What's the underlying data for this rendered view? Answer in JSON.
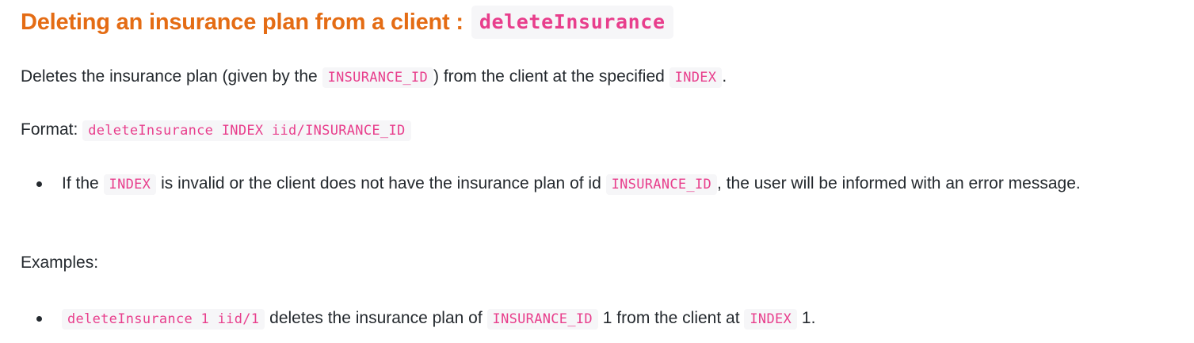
{
  "heading": {
    "text": "Deleting an insurance plan from a client :",
    "command": "deleteInsurance"
  },
  "description": {
    "part1": "Deletes the insurance plan (given by the",
    "code1": "INSURANCE_ID",
    "part2": ") from the client at the specified",
    "code2": "INDEX",
    "part3": "."
  },
  "format": {
    "label": "Format:",
    "code": "deleteInsurance INDEX iid/INSURANCE_ID"
  },
  "notes": [
    {
      "part1": "If the",
      "code1": "INDEX",
      "part2": "is invalid or the client does not have the insurance plan of id",
      "code2": "INSURANCE_ID",
      "part3": ", the user will be informed with an error message."
    }
  ],
  "examples": {
    "label": "Examples:",
    "items": [
      {
        "code1": "deleteInsurance 1 iid/1",
        "part1": "deletes the insurance plan of",
        "code2": "INSURANCE_ID",
        "part2": "1 from the client at",
        "code3": "INDEX",
        "part3": "1."
      }
    ]
  }
}
